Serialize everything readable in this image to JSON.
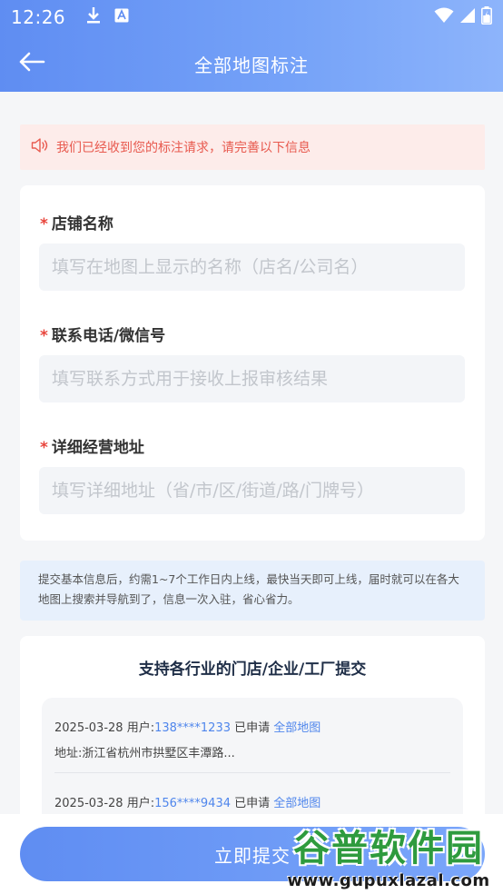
{
  "status_bar": {
    "time": "12:26"
  },
  "header": {
    "title": "全部地图标注"
  },
  "notice": {
    "text": "我们已经收到您的标注请求，请完善以下信息"
  },
  "form": {
    "required_mark": "*",
    "fields": [
      {
        "label": "店铺名称",
        "placeholder": "填写在地图上显示的名称（店名/公司名）",
        "value": ""
      },
      {
        "label": "联系电话/微信号",
        "placeholder": "填写联系方式用于接收上报审核结果",
        "value": ""
      },
      {
        "label": "详细经营地址",
        "placeholder": "填写详细地址（省/市/区/街道/路/门牌号）",
        "value": ""
      }
    ]
  },
  "info": {
    "text": "提交基本信息后，约需1~7个工作日内上线，最快当天即可上线，届时就可以在各大地图上搜索并导航到了，信息一次入驻，省心省力。"
  },
  "support": {
    "title": "支持各行业的门店/企业/工厂提交",
    "records": [
      {
        "date": "2025-03-28",
        "user_label": "用户:",
        "phone": "138****1233",
        "applied": "已申请",
        "product": "全部地图",
        "address": "地址:浙江省杭州市拱墅区丰潭路..."
      },
      {
        "date": "2025-03-28",
        "user_label": "用户:",
        "phone": "156****9434",
        "applied": "已申请",
        "product": "全部地图",
        "address": ""
      }
    ]
  },
  "submit": {
    "label": "立即提交"
  },
  "watermark": {
    "main": "谷普软件园",
    "sub": "www.gupuxlazal.com"
  },
  "colors": {
    "accent": "#5f8df2",
    "notice_text": "#e85a4f",
    "required": "#e8453c",
    "link": "#4f86ec"
  }
}
